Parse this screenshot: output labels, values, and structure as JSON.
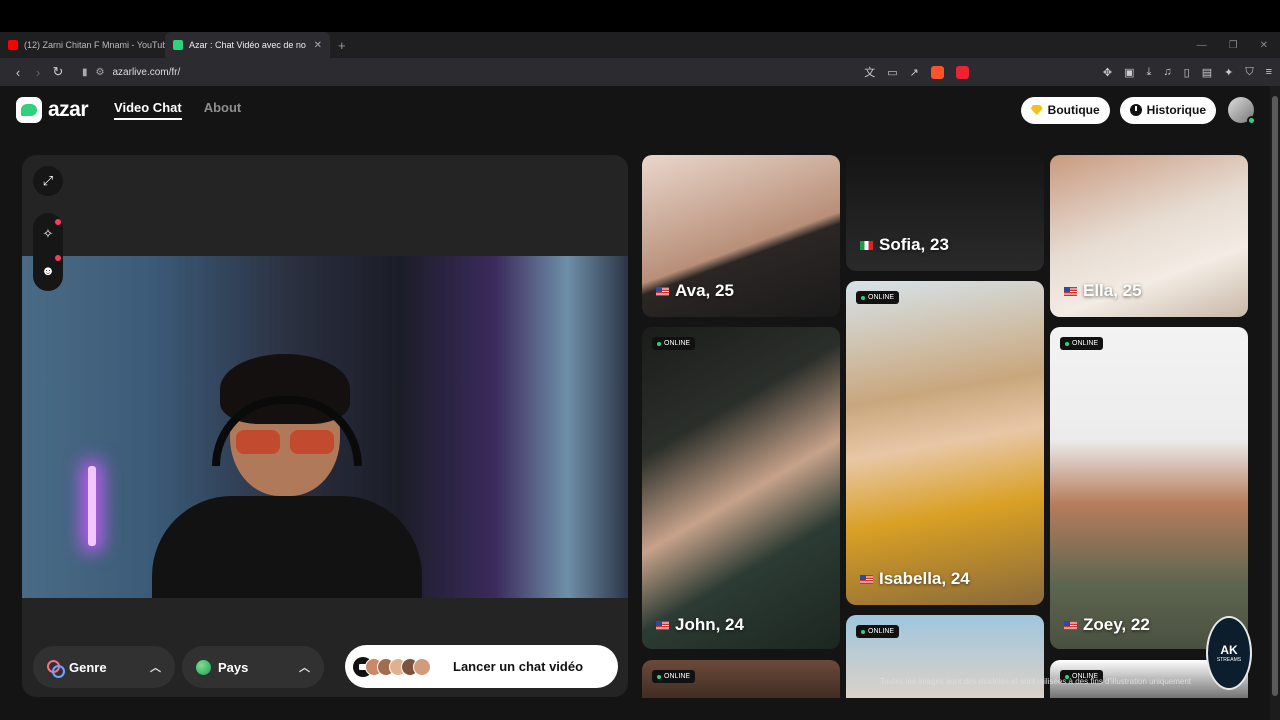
{
  "browser": {
    "tabs": [
      {
        "title": "(12) Zarni Chitan F Mnami - YouTube",
        "favicon_color": "#ff0000",
        "active": false
      },
      {
        "title": "Azar : Chat Vidéo avec de no",
        "favicon_color": "#2ed27a",
        "active": true
      }
    ],
    "new_tab": "+",
    "url": "azarlive.com/fr/",
    "window_controls": [
      "—",
      "❐",
      "✕"
    ]
  },
  "header": {
    "logo_text": "azar",
    "nav": [
      {
        "label": "Video Chat",
        "active": true
      },
      {
        "label": "About",
        "active": false
      }
    ],
    "shop_label": "Boutique",
    "history_label": "Historique"
  },
  "video": {
    "filters": [
      {
        "label": "Genre",
        "icon": "gender-icon"
      },
      {
        "label": "Pays",
        "icon": "globe-icon"
      }
    ],
    "launch_label": "Lancer un chat vidéo"
  },
  "profiles": [
    {
      "name": "Ava, 25",
      "flag": "us",
      "online": false
    },
    {
      "name": "Sofia, 23",
      "flag": "it",
      "online": false
    },
    {
      "name": "Ella, 25",
      "flag": "us",
      "online": false
    },
    {
      "name": "John, 24",
      "flag": "us",
      "online": true
    },
    {
      "name": "Isabella, 24",
      "flag": "us",
      "online": true
    },
    {
      "name": "Zoey, 22",
      "flag": "us",
      "online": true
    },
    {
      "name": "",
      "flag": "",
      "online": true
    },
    {
      "name": "",
      "flag": "",
      "online": true
    },
    {
      "name": "",
      "flag": "",
      "online": true
    }
  ],
  "online_label": "ONLINE",
  "disclaimer": "Toutes les images sont des modèles et sont utilisées à des fins d'illustration uniquement",
  "watermark": {
    "text": "AK",
    "subtext": "STREAMS"
  }
}
